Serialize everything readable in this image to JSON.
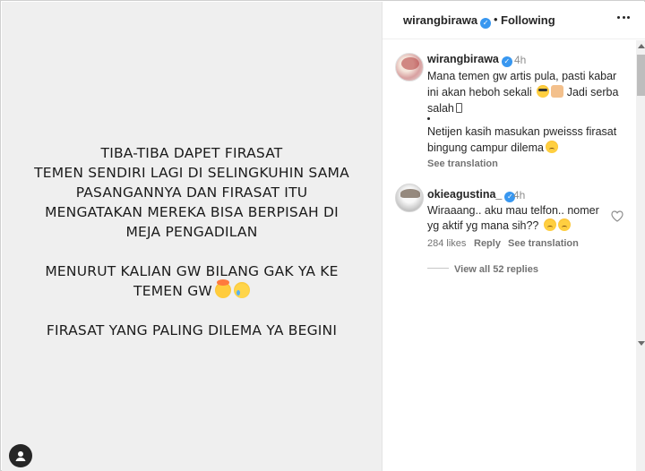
{
  "post": {
    "lines": [
      "TIBA-TIBA DAPET FIRASAT",
      "TEMEN SENDIRI LAGI DI SELINGKUHIN SAMA",
      "PASANGANNYA DAN FIRASAT ITU",
      "MENGATAKAN MEREKA BISA BERPISAH DI",
      "MEJA PENGADILAN",
      "MENURUT KALIAN GW BILANG GAK YA KE",
      "TEMEN GW",
      "FIRASAT YANG PALING DILEMA YA BEGINI"
    ],
    "background": "#efefef"
  },
  "header": {
    "username": "wirangbirawa",
    "separator": "•",
    "follow_status": "Following"
  },
  "caption": {
    "username": "wirangbirawa",
    "time": "4h",
    "line1": "Mana temen gw artis pula, pasti kabar",
    "line2": "ini akan heboh sekali",
    "line2b": "Jadi serba",
    "line3": "salah",
    "line5": "Netijen kasih masukan pweisss firasat",
    "line6": "bingung campur dilema",
    "see_translation": "See translation"
  },
  "comment": {
    "username": "okieagustina_",
    "time": "4h",
    "line1": "Wiraaang.. aku mau telfon.. nomer",
    "line2": "yg aktif yg mana sih??",
    "likes": "284 likes",
    "reply": "Reply",
    "see_translation": "See translation"
  },
  "view_all": "View all 52 replies",
  "colors": {
    "verified": "#3897f0",
    "text": "#262626",
    "muted": "#8e8e8e"
  },
  "icons": [
    "verified-icon",
    "more-options-icon",
    "heart-icon",
    "user-circle-icon"
  ]
}
